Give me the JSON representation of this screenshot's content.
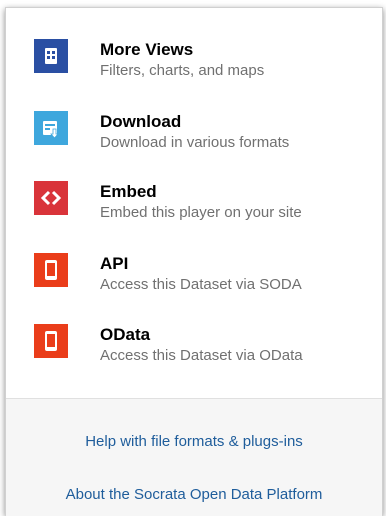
{
  "menu": {
    "items": [
      {
        "title": "More Views",
        "description": "Filters, charts, and maps",
        "icon": "more-views-icon",
        "color": "#2a4fa3"
      },
      {
        "title": "Download",
        "description": "Download in various formats",
        "icon": "download-icon",
        "color": "#3ea7dd"
      },
      {
        "title": "Embed",
        "description": "Embed this player on your site",
        "icon": "embed-icon",
        "color": "#d9343a"
      },
      {
        "title": "API",
        "description": "Access this Dataset via SODA",
        "icon": "phone-icon",
        "color": "#ea3d1a"
      },
      {
        "title": "OData",
        "description": "Access this Dataset via OData",
        "icon": "phone-icon",
        "color": "#ea3d1a"
      }
    ]
  },
  "footer": {
    "help_link": "Help with file formats & plugs-ins",
    "about_link": "About the Socrata Open Data Platform",
    "link_color": "#1f5d9b"
  }
}
